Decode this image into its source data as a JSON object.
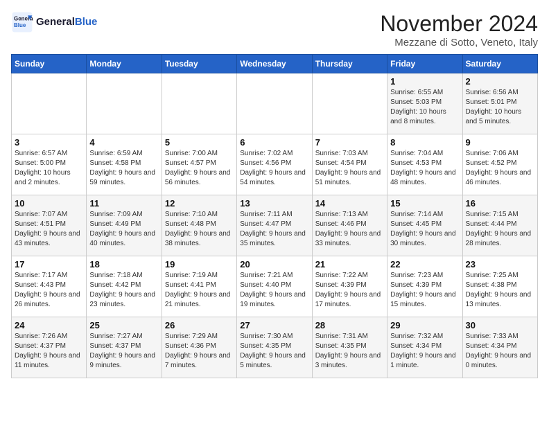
{
  "logo": {
    "line1": "General",
    "line2": "Blue"
  },
  "title": "November 2024",
  "location": "Mezzane di Sotto, Veneto, Italy",
  "days_of_week": [
    "Sunday",
    "Monday",
    "Tuesday",
    "Wednesday",
    "Thursday",
    "Friday",
    "Saturday"
  ],
  "weeks": [
    [
      {
        "day": "",
        "info": ""
      },
      {
        "day": "",
        "info": ""
      },
      {
        "day": "",
        "info": ""
      },
      {
        "day": "",
        "info": ""
      },
      {
        "day": "",
        "info": ""
      },
      {
        "day": "1",
        "info": "Sunrise: 6:55 AM\nSunset: 5:03 PM\nDaylight: 10 hours and 8 minutes."
      },
      {
        "day": "2",
        "info": "Sunrise: 6:56 AM\nSunset: 5:01 PM\nDaylight: 10 hours and 5 minutes."
      }
    ],
    [
      {
        "day": "3",
        "info": "Sunrise: 6:57 AM\nSunset: 5:00 PM\nDaylight: 10 hours and 2 minutes."
      },
      {
        "day": "4",
        "info": "Sunrise: 6:59 AM\nSunset: 4:58 PM\nDaylight: 9 hours and 59 minutes."
      },
      {
        "day": "5",
        "info": "Sunrise: 7:00 AM\nSunset: 4:57 PM\nDaylight: 9 hours and 56 minutes."
      },
      {
        "day": "6",
        "info": "Sunrise: 7:02 AM\nSunset: 4:56 PM\nDaylight: 9 hours and 54 minutes."
      },
      {
        "day": "7",
        "info": "Sunrise: 7:03 AM\nSunset: 4:54 PM\nDaylight: 9 hours and 51 minutes."
      },
      {
        "day": "8",
        "info": "Sunrise: 7:04 AM\nSunset: 4:53 PM\nDaylight: 9 hours and 48 minutes."
      },
      {
        "day": "9",
        "info": "Sunrise: 7:06 AM\nSunset: 4:52 PM\nDaylight: 9 hours and 46 minutes."
      }
    ],
    [
      {
        "day": "10",
        "info": "Sunrise: 7:07 AM\nSunset: 4:51 PM\nDaylight: 9 hours and 43 minutes."
      },
      {
        "day": "11",
        "info": "Sunrise: 7:09 AM\nSunset: 4:49 PM\nDaylight: 9 hours and 40 minutes."
      },
      {
        "day": "12",
        "info": "Sunrise: 7:10 AM\nSunset: 4:48 PM\nDaylight: 9 hours and 38 minutes."
      },
      {
        "day": "13",
        "info": "Sunrise: 7:11 AM\nSunset: 4:47 PM\nDaylight: 9 hours and 35 minutes."
      },
      {
        "day": "14",
        "info": "Sunrise: 7:13 AM\nSunset: 4:46 PM\nDaylight: 9 hours and 33 minutes."
      },
      {
        "day": "15",
        "info": "Sunrise: 7:14 AM\nSunset: 4:45 PM\nDaylight: 9 hours and 30 minutes."
      },
      {
        "day": "16",
        "info": "Sunrise: 7:15 AM\nSunset: 4:44 PM\nDaylight: 9 hours and 28 minutes."
      }
    ],
    [
      {
        "day": "17",
        "info": "Sunrise: 7:17 AM\nSunset: 4:43 PM\nDaylight: 9 hours and 26 minutes."
      },
      {
        "day": "18",
        "info": "Sunrise: 7:18 AM\nSunset: 4:42 PM\nDaylight: 9 hours and 23 minutes."
      },
      {
        "day": "19",
        "info": "Sunrise: 7:19 AM\nSunset: 4:41 PM\nDaylight: 9 hours and 21 minutes."
      },
      {
        "day": "20",
        "info": "Sunrise: 7:21 AM\nSunset: 4:40 PM\nDaylight: 9 hours and 19 minutes."
      },
      {
        "day": "21",
        "info": "Sunrise: 7:22 AM\nSunset: 4:39 PM\nDaylight: 9 hours and 17 minutes."
      },
      {
        "day": "22",
        "info": "Sunrise: 7:23 AM\nSunset: 4:39 PM\nDaylight: 9 hours and 15 minutes."
      },
      {
        "day": "23",
        "info": "Sunrise: 7:25 AM\nSunset: 4:38 PM\nDaylight: 9 hours and 13 minutes."
      }
    ],
    [
      {
        "day": "24",
        "info": "Sunrise: 7:26 AM\nSunset: 4:37 PM\nDaylight: 9 hours and 11 minutes."
      },
      {
        "day": "25",
        "info": "Sunrise: 7:27 AM\nSunset: 4:37 PM\nDaylight: 9 hours and 9 minutes."
      },
      {
        "day": "26",
        "info": "Sunrise: 7:29 AM\nSunset: 4:36 PM\nDaylight: 9 hours and 7 minutes."
      },
      {
        "day": "27",
        "info": "Sunrise: 7:30 AM\nSunset: 4:35 PM\nDaylight: 9 hours and 5 minutes."
      },
      {
        "day": "28",
        "info": "Sunrise: 7:31 AM\nSunset: 4:35 PM\nDaylight: 9 hours and 3 minutes."
      },
      {
        "day": "29",
        "info": "Sunrise: 7:32 AM\nSunset: 4:34 PM\nDaylight: 9 hours and 1 minute."
      },
      {
        "day": "30",
        "info": "Sunrise: 7:33 AM\nSunset: 4:34 PM\nDaylight: 9 hours and 0 minutes."
      }
    ]
  ]
}
